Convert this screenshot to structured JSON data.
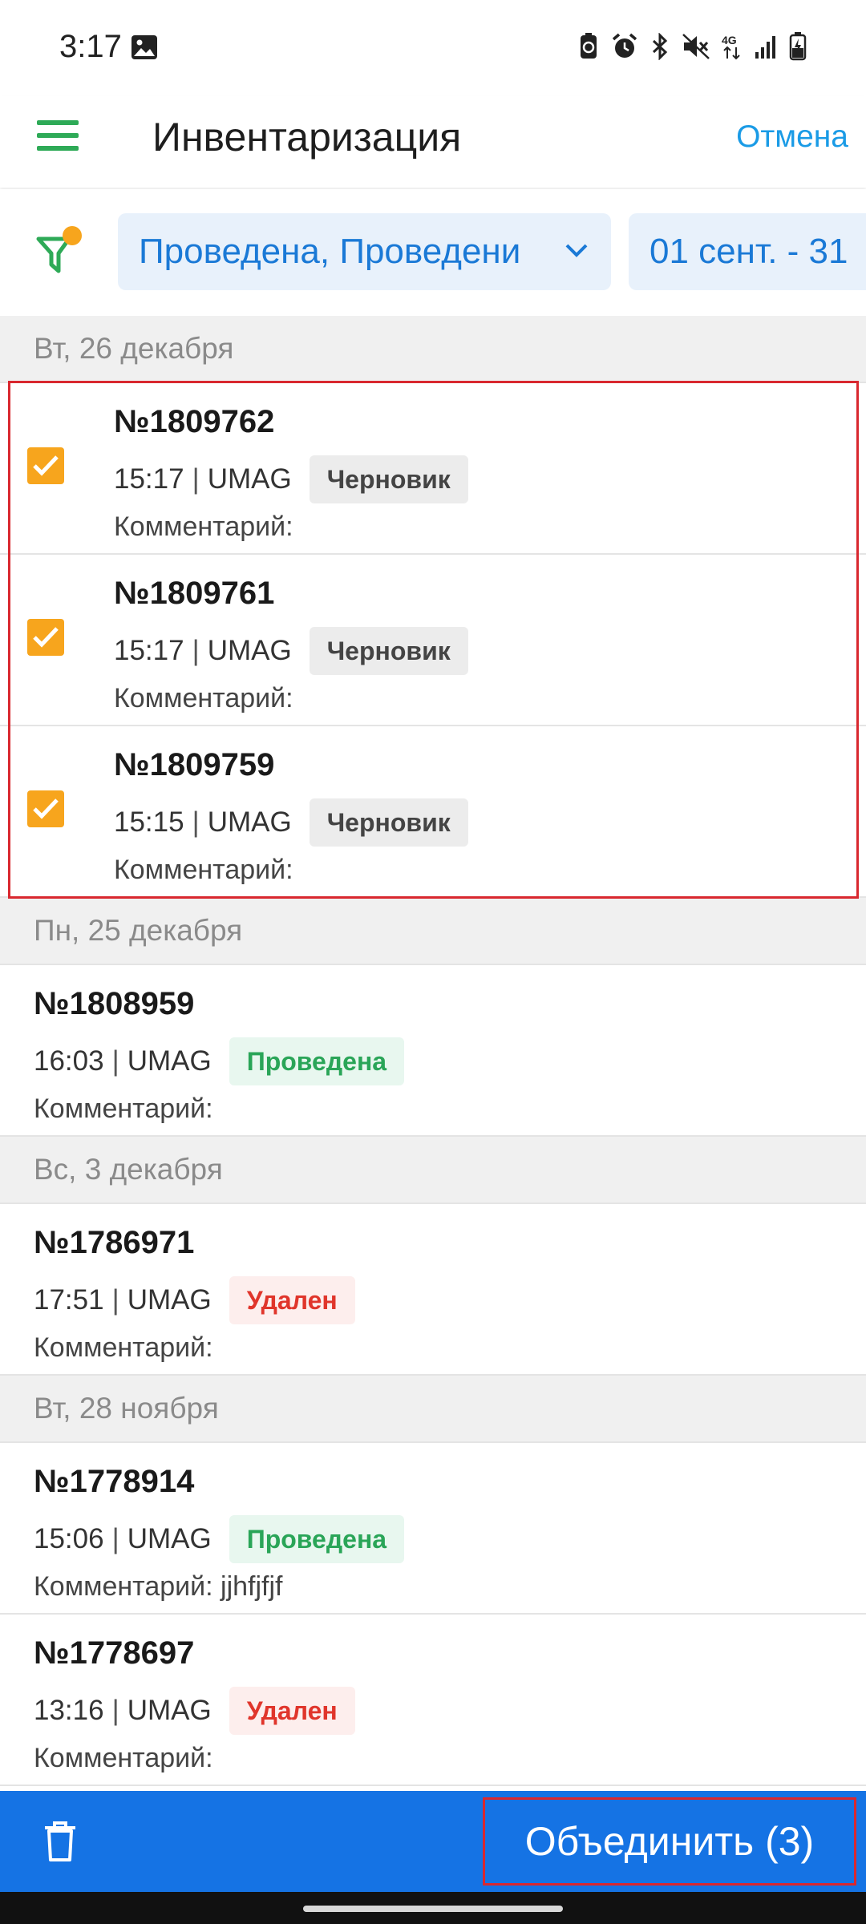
{
  "status_bar": {
    "time": "3:17",
    "network": "4G"
  },
  "app_bar": {
    "title": "Инвентаризация",
    "cancel_label": "Отмена"
  },
  "filters": {
    "status_value": "Проведена, Проведени",
    "date_range": "01 сент. - 31"
  },
  "groups": [
    {
      "date": "Вт, 26 декабря",
      "selected": true,
      "items": [
        {
          "number": "№1809762",
          "time": "15:17",
          "store": "UMAG",
          "status": "Черновик",
          "status_kind": "draft",
          "comment": "Комментарий:"
        },
        {
          "number": "№1809761",
          "time": "15:17",
          "store": "UMAG",
          "status": "Черновик",
          "status_kind": "draft",
          "comment": "Комментарий:"
        },
        {
          "number": "№1809759",
          "time": "15:15",
          "store": "UMAG",
          "status": "Черновик",
          "status_kind": "draft",
          "comment": "Комментарий:"
        }
      ]
    },
    {
      "date": "Пн, 25 декабря",
      "items": [
        {
          "number": "№1808959",
          "time": "16:03",
          "store": "UMAG",
          "status": "Проведена",
          "status_kind": "done",
          "comment": "Комментарий:"
        }
      ]
    },
    {
      "date": "Вс, 3 декабря",
      "items": [
        {
          "number": "№1786971",
          "time": "17:51",
          "store": "UMAG",
          "status": "Удален",
          "status_kind": "deleted",
          "comment": "Комментарий:"
        }
      ]
    },
    {
      "date": "Вт, 28 ноября",
      "items": [
        {
          "number": "№1778914",
          "time": "15:06",
          "store": "UMAG",
          "status": "Проведена",
          "status_kind": "done",
          "comment": "Комментарий: jjhfjfjf"
        },
        {
          "number": "№1778697",
          "time": "13:16",
          "store": "UMAG",
          "status": "Удален",
          "status_kind": "deleted",
          "comment": "Комментарий:"
        }
      ]
    }
  ],
  "bottom_bar": {
    "merge_label": "Объединить (3)"
  },
  "colors": {
    "accent_green": "#2eaa57",
    "link_blue": "#1a9be6",
    "bar_blue": "#1573e4",
    "checkbox_orange": "#f7a51d",
    "selection_red": "#d9282f"
  },
  "icons": {
    "menu": "hamburger-icon",
    "filter": "filter-icon",
    "delete": "trash-icon",
    "check": "check-icon"
  }
}
